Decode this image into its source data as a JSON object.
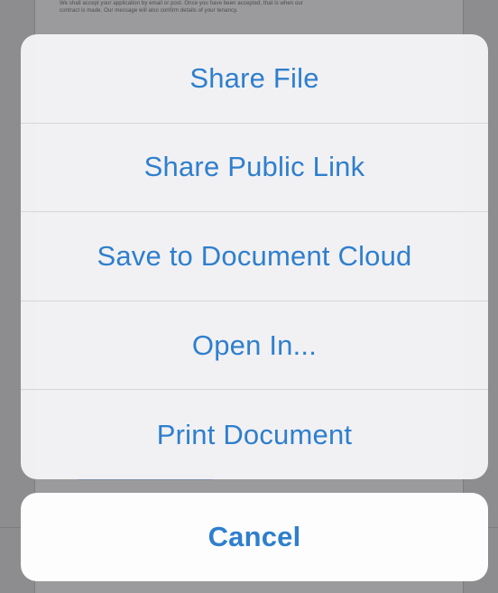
{
  "background_document": {
    "lines": [
      "We shall accept your application by email or post. Once you have been accepted, that is when our",
      "contract is made. Our message will also confirm details of your tenancy."
    ]
  },
  "action_sheet": {
    "items": [
      {
        "label": "Share File"
      },
      {
        "label": "Share Public Link"
      },
      {
        "label": "Save to Document Cloud"
      },
      {
        "label": "Open In..."
      },
      {
        "label": "Print Document"
      }
    ],
    "cancel_label": "Cancel"
  },
  "colors": {
    "accent": "#2f7fcd",
    "sheet_background": "#f4f4f6",
    "overlay": "#8e8e90"
  }
}
